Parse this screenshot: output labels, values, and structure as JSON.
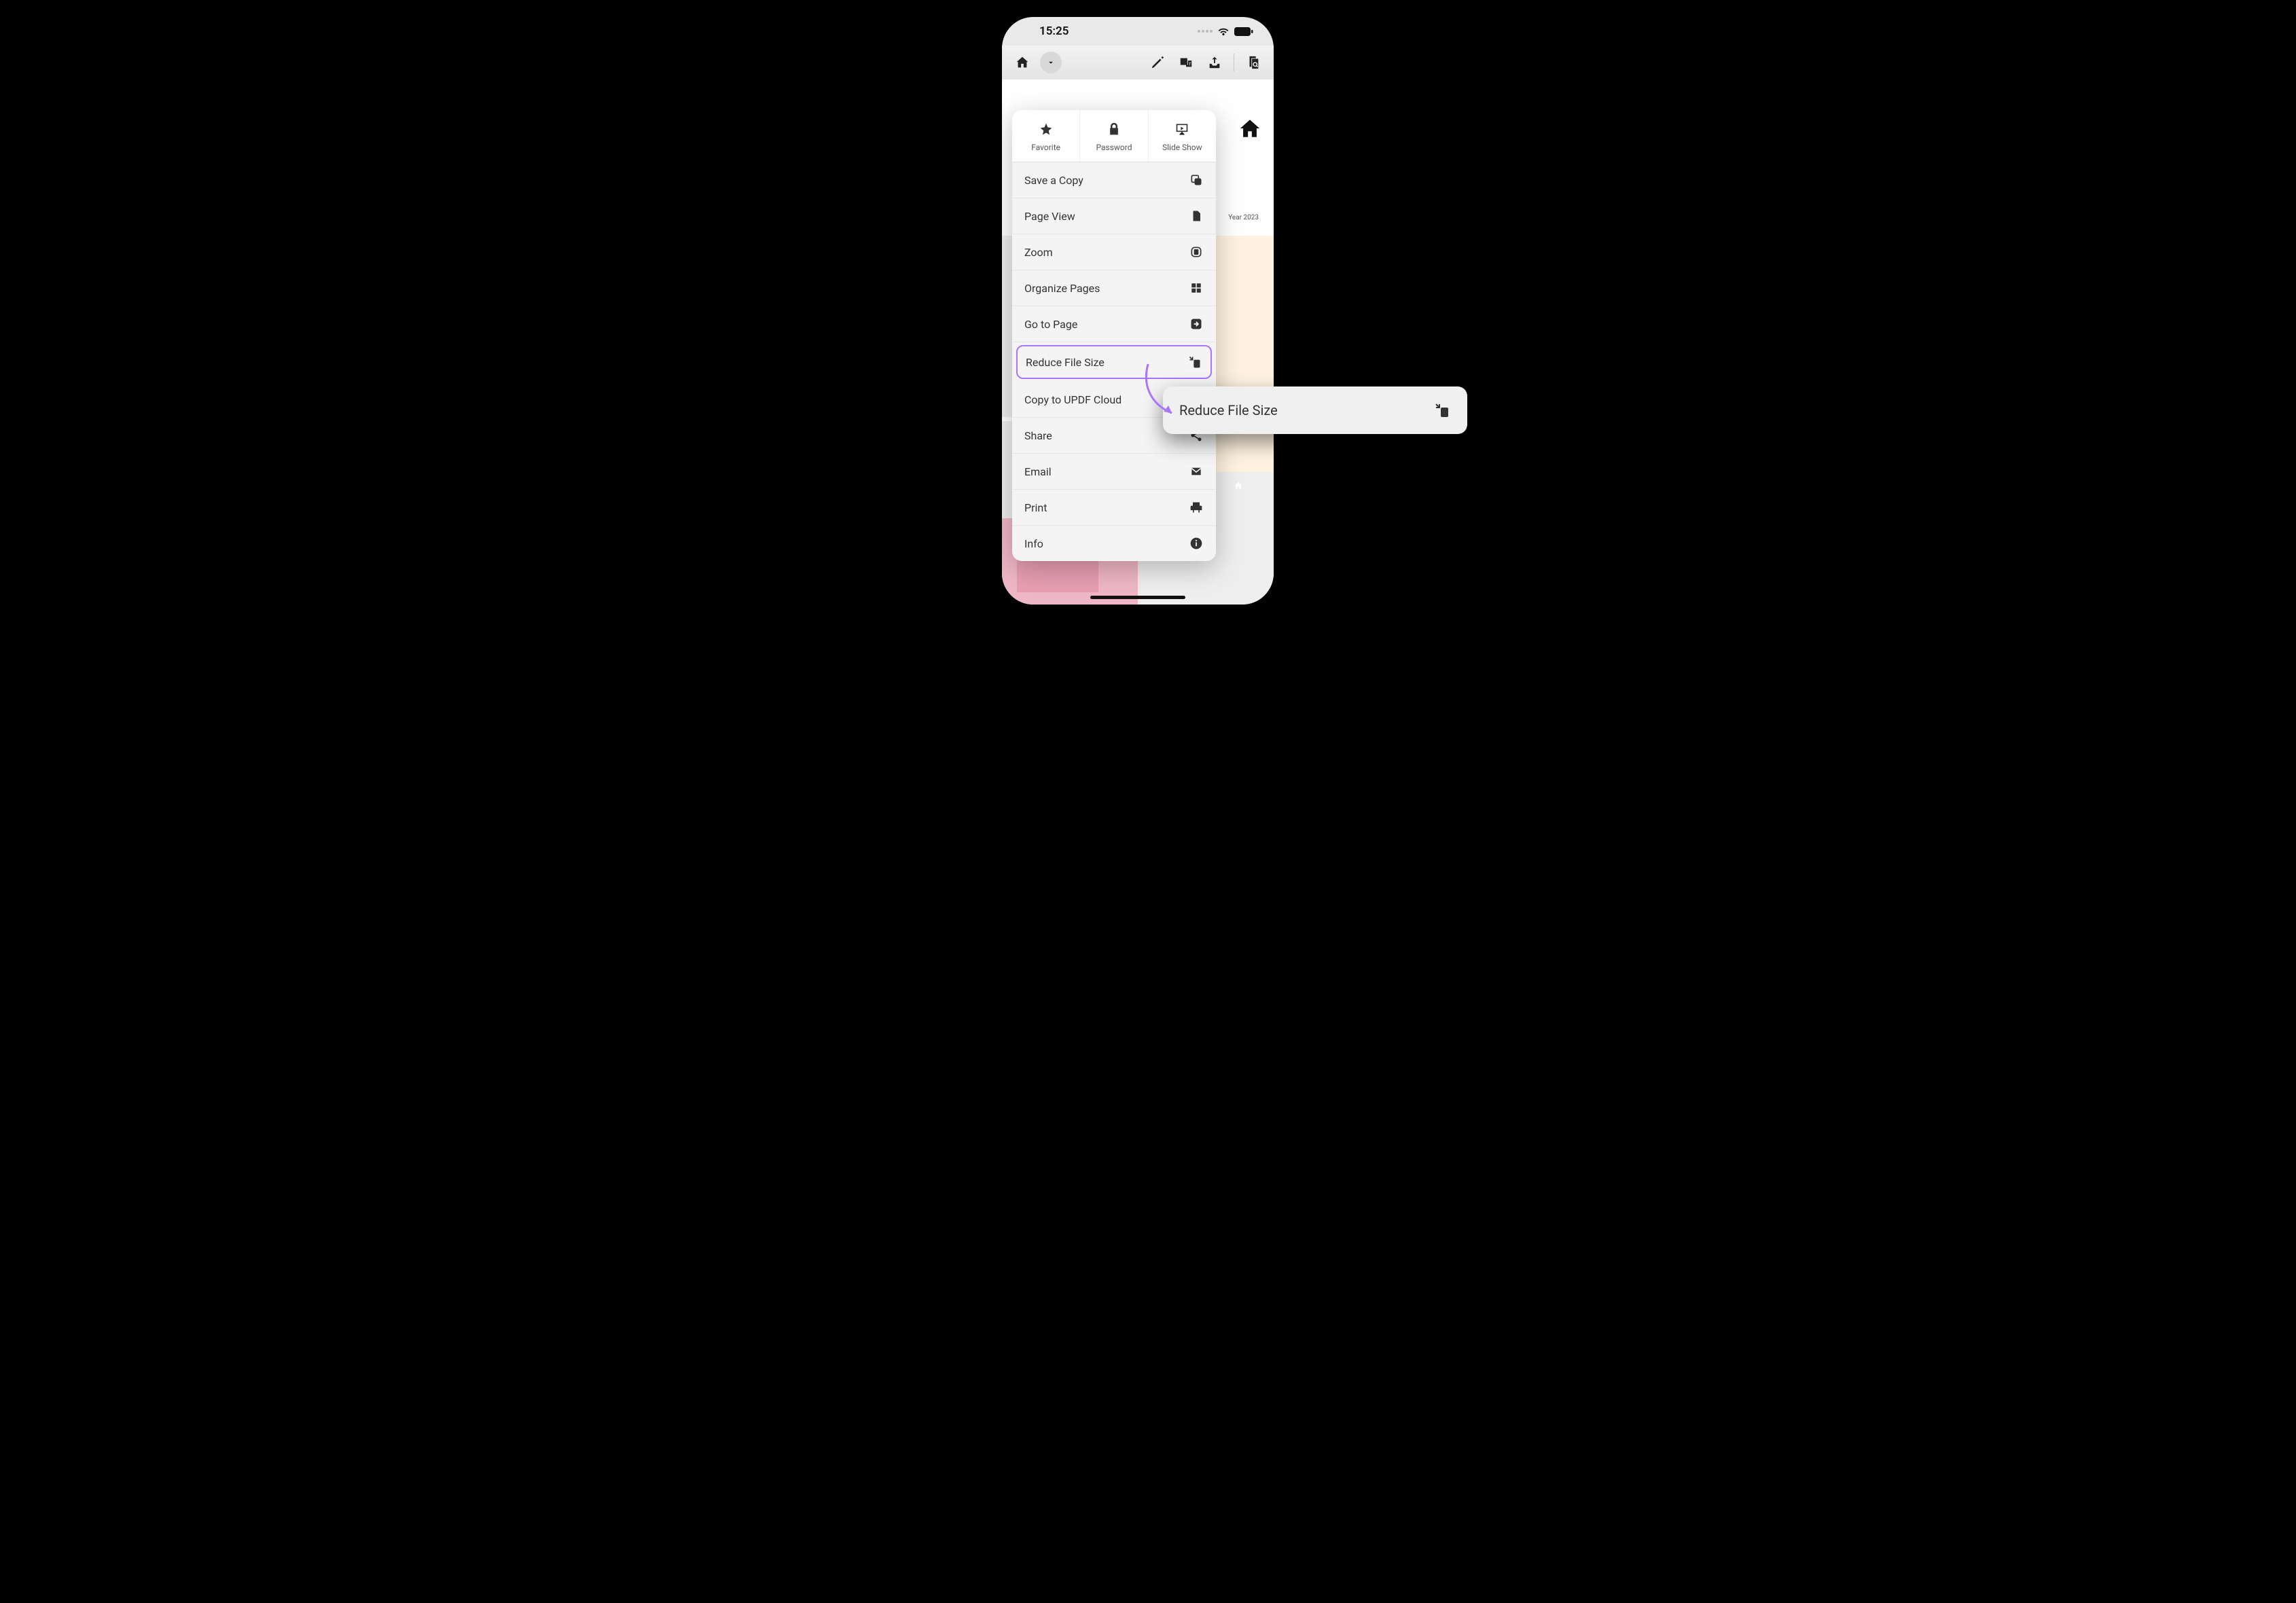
{
  "status": {
    "time": "15:25"
  },
  "bg": {
    "year": "Year 2023"
  },
  "top_actions": {
    "favorite": "Favorite",
    "password": "Password",
    "slideshow": "Slide Show"
  },
  "menu": {
    "save_copy": "Save a Copy",
    "page_view": "Page View",
    "zoom": "Zoom",
    "organize": "Organize Pages",
    "goto": "Go to Page",
    "reduce": "Reduce File Size",
    "cloud": "Copy to UPDF Cloud",
    "share": "Share",
    "email": "Email",
    "print": "Print",
    "info": "Info"
  },
  "callout": {
    "label": "Reduce File Size"
  }
}
